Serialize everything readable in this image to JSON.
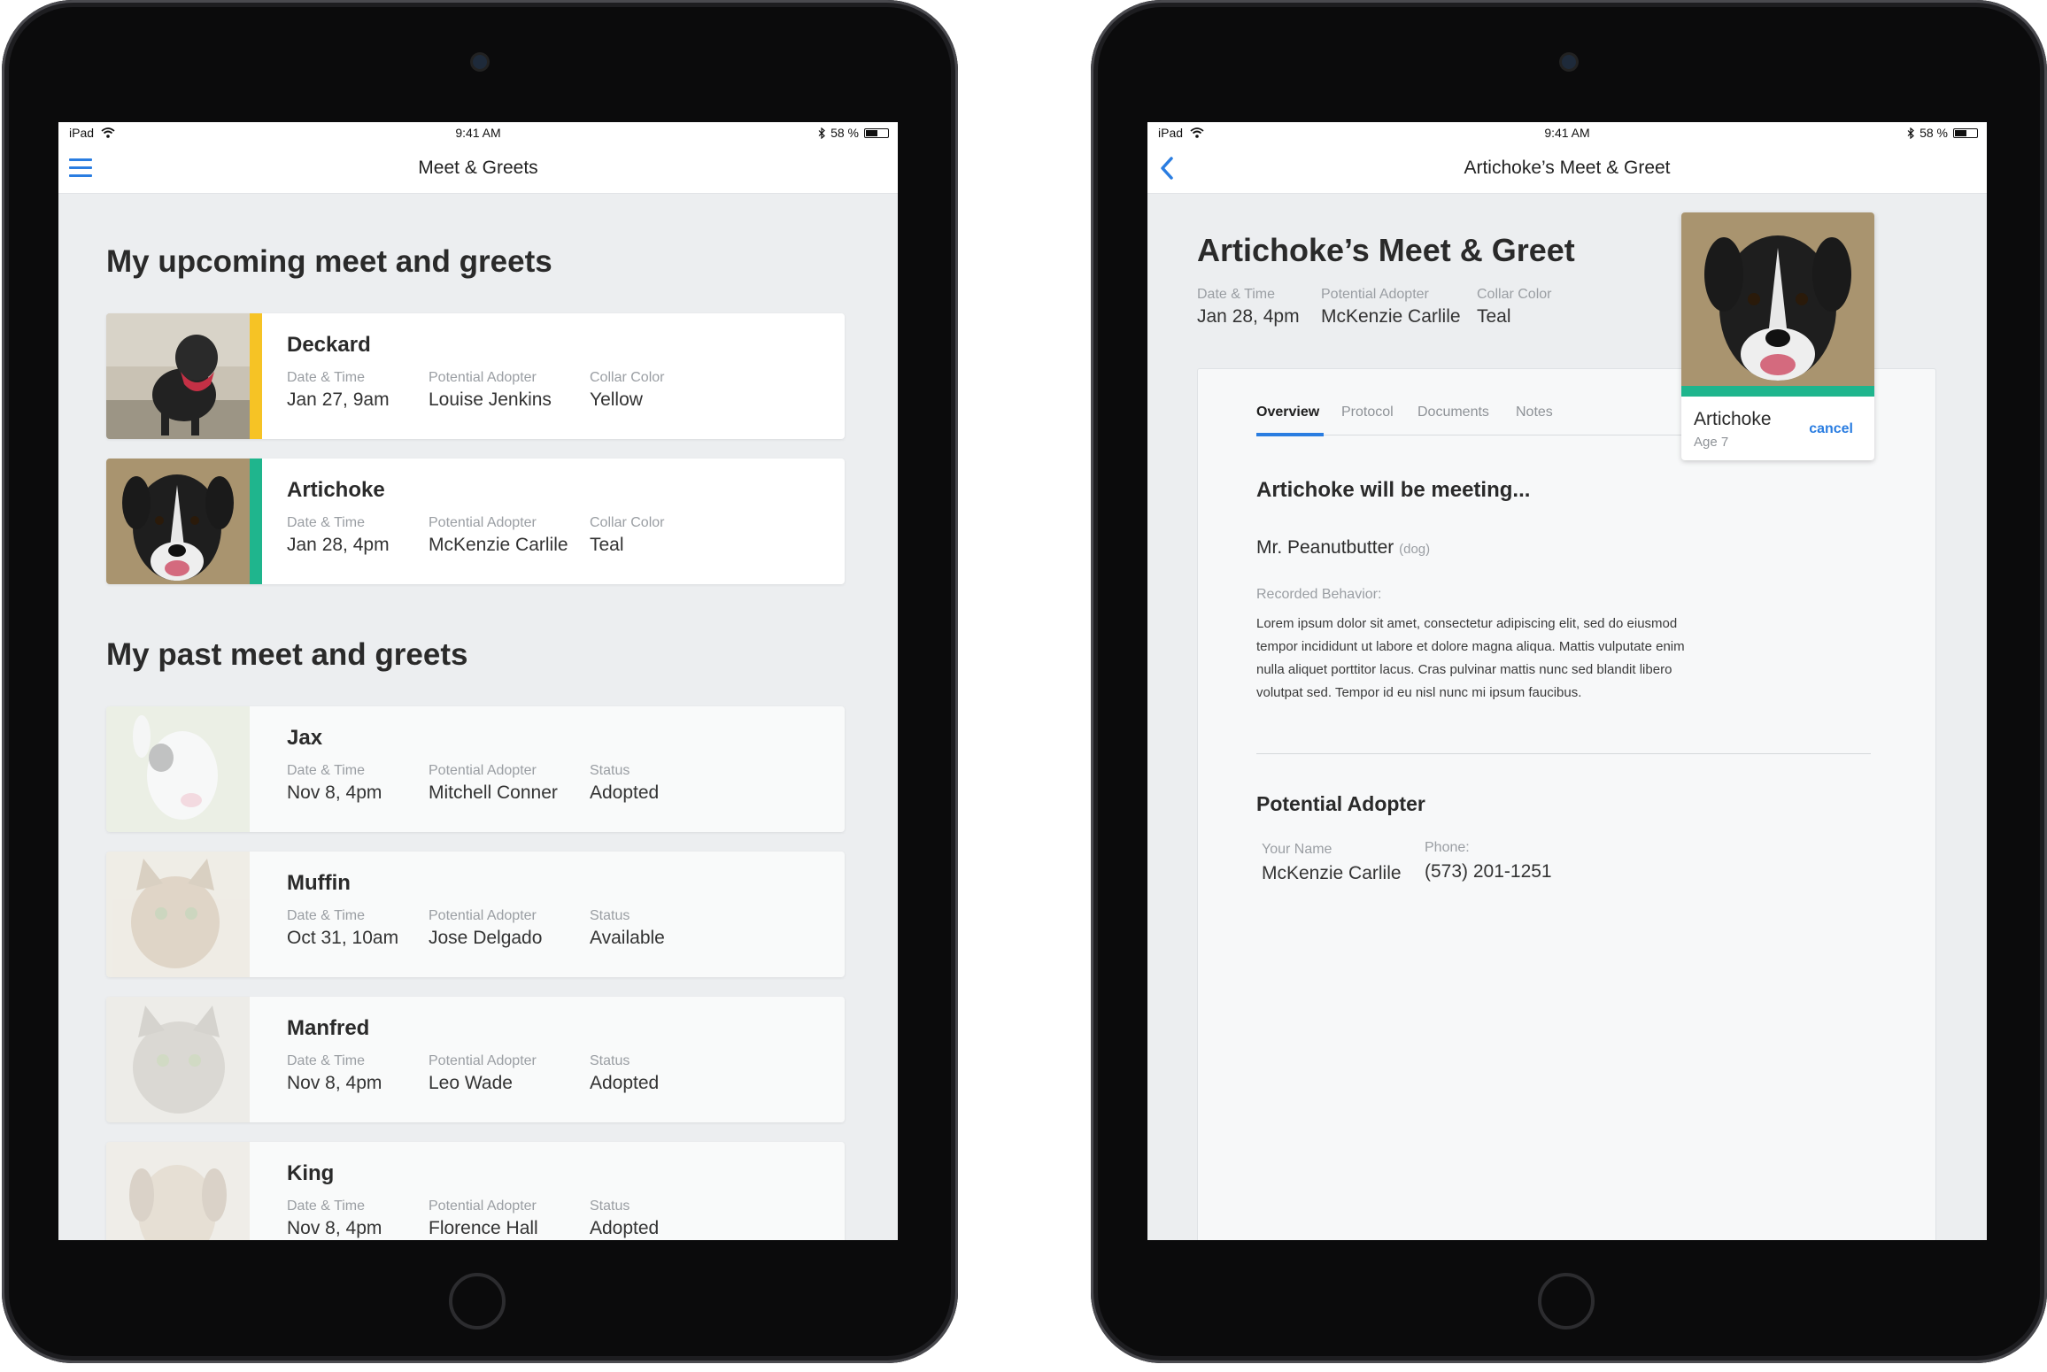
{
  "left_screen": {
    "status": {
      "device": "iPad",
      "time": "9:41 AM",
      "battery": "58 %"
    },
    "nav_title": "Meet & Greets",
    "upcoming_title": "My upcoming meet and greets",
    "past_title": "My past meet and greets",
    "upcoming": [
      {
        "name": "Deckard",
        "date_label": "Date & Time",
        "date": "Jan 27, 9am",
        "adopter_label": "Potential Adopter",
        "adopter": "Louise Jenkins",
        "third_label": "Collar Color",
        "third": "Yellow",
        "band_color": "#f6c325"
      },
      {
        "name": "Artichoke",
        "date_label": "Date & Time",
        "date": "Jan 28, 4pm",
        "adopter_label": "Potential Adopter",
        "adopter": "McKenzie Carlile",
        "third_label": "Collar Color",
        "third": "Teal",
        "band_color": "#1fb58d"
      }
    ],
    "past": [
      {
        "name": "Jax",
        "date_label": "Date & Time",
        "date": "Nov 8, 4pm",
        "adopter_label": "Potential Adopter",
        "adopter": "Mitchell Conner",
        "third_label": "Status",
        "third": "Adopted"
      },
      {
        "name": "Muffin",
        "date_label": "Date & Time",
        "date": "Oct 31, 10am",
        "adopter_label": "Potential Adopter",
        "adopter": "Jose Delgado",
        "third_label": "Status",
        "third": "Available"
      },
      {
        "name": "Manfred",
        "date_label": "Date & Time",
        "date": "Nov 8, 4pm",
        "adopter_label": "Potential Adopter",
        "adopter": "Leo Wade",
        "third_label": "Status",
        "third": "Adopted"
      },
      {
        "name": "King",
        "date_label": "Date & Time",
        "date": "Nov 8, 4pm",
        "adopter_label": "Potential Adopter",
        "adopter": "Florence Hall",
        "third_label": "Status",
        "third": "Adopted"
      }
    ]
  },
  "right_screen": {
    "status": {
      "device": "iPad",
      "time": "9:41 AM",
      "battery": "58 %"
    },
    "nav_title": "Artichoke’s Meet & Greet",
    "title": "Artichoke’s Meet & Greet",
    "date_label": "Date & Time",
    "date": "Jan 28, 4pm",
    "adopter_label": "Potential Adopter",
    "adopter": "McKenzie Carlile",
    "collar_label": "Collar Color",
    "collar": "Teal",
    "tabs": [
      "Overview",
      "Protocol",
      "Documents",
      "Notes"
    ],
    "meeting_title": "Artichoke will be meeting...",
    "peer_name": "Mr. Peanutbutter",
    "peer_kind": "(dog)",
    "behavior_label": "Recorded Behavior:",
    "behavior_text": "Lorem ipsum dolor sit amet, consectetur adipiscing elit, sed do eiusmod tempor incididunt ut labore et dolore magna aliqua. Mattis vulputate enim nulla aliquet porttitor lacus. Cras pulvinar mattis nunc sed blandit libero volutpat sed. Tempor id eu nisl nunc mi ipsum faucibus.",
    "pa_title": "Potential Adopter",
    "your_name_label": "Your Name",
    "your_name": "McKenzie Carlile",
    "phone_label": "Phone:",
    "phone": "(573) 201-1251",
    "pet_card": {
      "name": "Artichoke",
      "age": "Age 7",
      "cancel": "cancel"
    }
  },
  "colors": {
    "accent": "#2a7de1",
    "teal": "#1fb58d",
    "yellow": "#f6c325"
  },
  "battery_level": 0.58
}
